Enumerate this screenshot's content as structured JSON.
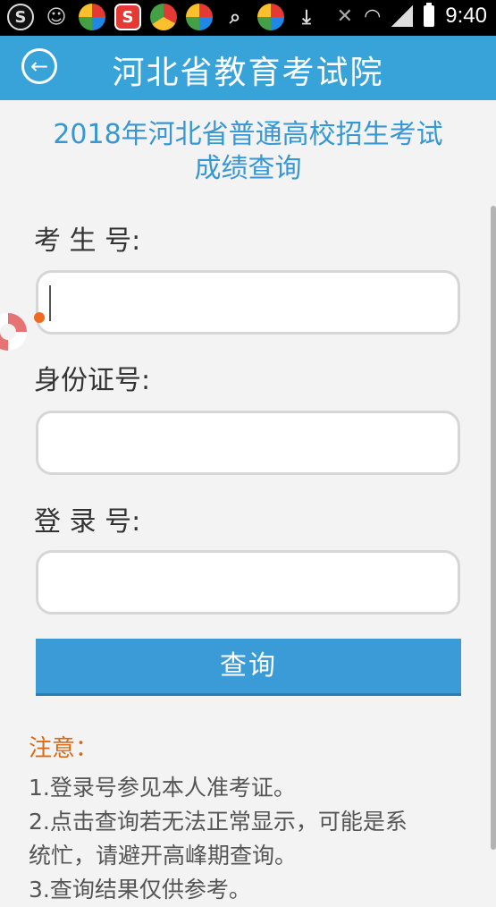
{
  "status_bar": {
    "time": "9:40",
    "icons": [
      "s-circle-icon",
      "owl-icon",
      "pinwheel-icon",
      "s-red-icon",
      "chrome-icon",
      "pinwheel-icon",
      "search-icon",
      "pinwheel-icon",
      "download-icon",
      "mute-icon",
      "wifi-icon",
      "signal-icon",
      "battery-icon"
    ]
  },
  "header": {
    "title": "河北省教育考试院",
    "back_icon": "back-arrow-icon",
    "bg_color": "#37a3d9"
  },
  "page": {
    "subtitle_line1": "2018年河北省普通高校招生考试",
    "subtitle_line2": "成绩查询"
  },
  "form": {
    "candidate_label": "考 生 号:",
    "candidate_value": "",
    "id_label": "身份证号:",
    "id_value": "",
    "login_label": "登 录 号:",
    "login_value": "",
    "submit_label": "查询"
  },
  "notice": {
    "title": "注意：",
    "lines": [
      "1.登录号参见本人准考证。",
      "2.点击查询若无法正常显示，可能是系",
      "统忙，请避开高峰期查询。",
      "3.查询结果仅供参考。"
    ]
  },
  "colors": {
    "accent": "#3797d3",
    "notice": "#d86b17",
    "button": "#3b9bd6"
  }
}
